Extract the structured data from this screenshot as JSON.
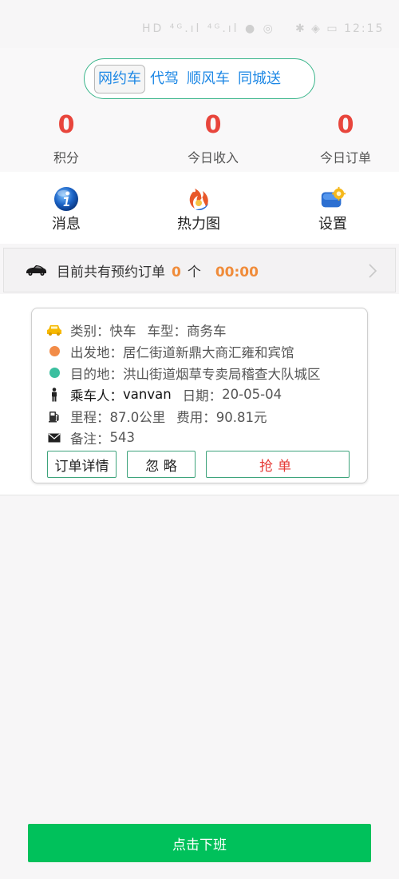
{
  "status_bar": {
    "left_icons": "HD ⁴ᴳ.ıl ⁴ᴳ.ıl ● ◎",
    "right_icons": "✱ ◈ ▭",
    "time": "12:15"
  },
  "service_tabs": [
    {
      "label": "网约车",
      "active": true
    },
    {
      "label": "代驾",
      "active": false
    },
    {
      "label": "顺风车",
      "active": false
    },
    {
      "label": "同城送",
      "active": false
    }
  ],
  "stats": [
    {
      "value": "0",
      "label": "积分"
    },
    {
      "value": "0",
      "label": "今日收入"
    },
    {
      "value": "0",
      "label": "今日订单"
    }
  ],
  "menu": [
    {
      "label": "消息",
      "icon": "info-icon"
    },
    {
      "label": "热力图",
      "icon": "heatmap-icon"
    },
    {
      "label": "设置",
      "icon": "settings-icon"
    }
  ],
  "booking": {
    "text": "目前共有预约订单",
    "count": "0",
    "unit": "个",
    "time": "00:00"
  },
  "order": {
    "category_label": "类别：",
    "category": "快车",
    "car_type_label": "车型：",
    "car_type": "商务车",
    "departure_label": "出发地：",
    "departure": "居仁街道新鼎大商汇雍和宾馆",
    "destination_label": "目的地：",
    "destination": "洪山街道烟草专卖局稽查大队城区",
    "passenger_label": "乘车人：",
    "passenger": "vanvan",
    "date_label": "日期：",
    "date": "20-05-04",
    "mileage_label": "里程：",
    "mileage": "87.0公里",
    "fee_label": "费用：",
    "fee": "90.81元",
    "note_label": "备注：",
    "note": "543",
    "colors": {
      "departure_dot": "#f28c48",
      "destination_dot": "#3bbf9f",
      "taxi": "#f6b800"
    }
  },
  "buttons": {
    "details": "订单详情",
    "ignore": "忽 略",
    "grab": "抢单",
    "off_duty": "点击下班"
  },
  "colors": {
    "accent_green": "#00c15b",
    "stat_red": "#e8453c",
    "link_blue": "#1e88e5",
    "booking_orange": "#f08c3a"
  }
}
